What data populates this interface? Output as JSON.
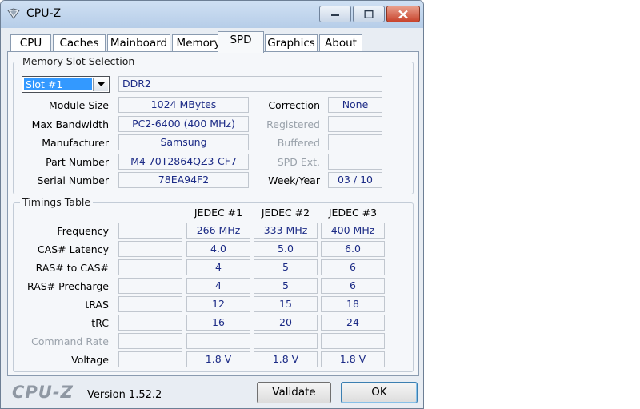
{
  "window": {
    "title": "CPU-Z"
  },
  "tabs": [
    "CPU",
    "Caches",
    "Mainboard",
    "Memory",
    "SPD",
    "Graphics",
    "About"
  ],
  "slot_section": {
    "title": "Memory Slot Selection",
    "slot_selected": "Slot #1",
    "memory_type": "DDR2",
    "module_size_label": "Module Size",
    "module_size": "1024 MBytes",
    "max_bandwidth_label": "Max Bandwidth",
    "max_bandwidth": "PC2-6400 (400 MHz)",
    "manufacturer_label": "Manufacturer",
    "manufacturer": "Samsung",
    "part_number_label": "Part Number",
    "part_number": "M4 70T2864QZ3-CF7",
    "serial_number_label": "Serial Number",
    "serial_number": "78EA94F2",
    "correction_label": "Correction",
    "correction": "None",
    "registered_label": "Registered",
    "registered": "",
    "buffered_label": "Buffered",
    "buffered": "",
    "spd_ext_label": "SPD Ext.",
    "spd_ext": "",
    "week_year_label": "Week/Year",
    "week_year": "03 / 10"
  },
  "timings": {
    "title": "Timings Table",
    "columns": [
      "JEDEC #1",
      "JEDEC #2",
      "JEDEC #3"
    ],
    "rows": [
      {
        "label": "Frequency",
        "values": [
          "266 MHz",
          "333 MHz",
          "400 MHz"
        ]
      },
      {
        "label": "CAS# Latency",
        "values": [
          "4.0",
          "5.0",
          "6.0"
        ]
      },
      {
        "label": "RAS# to CAS#",
        "values": [
          "4",
          "5",
          "6"
        ]
      },
      {
        "label": "RAS# Precharge",
        "values": [
          "4",
          "5",
          "6"
        ]
      },
      {
        "label": "tRAS",
        "values": [
          "12",
          "15",
          "18"
        ]
      },
      {
        "label": "tRC",
        "values": [
          "16",
          "20",
          "24"
        ]
      },
      {
        "label": "Command Rate",
        "values": [
          "",
          "",
          ""
        ]
      },
      {
        "label": "Voltage",
        "values": [
          "1.8 V",
          "1.8 V",
          "1.8 V"
        ]
      }
    ]
  },
  "footer": {
    "logo": "CPU-Z",
    "version": "Version 1.52.2",
    "validate_label": "Validate",
    "ok_label": "OK"
  },
  "colors": {
    "value_text": "#1c2b86",
    "title_bar": "#b6cde8",
    "close_button": "#c8432c"
  }
}
